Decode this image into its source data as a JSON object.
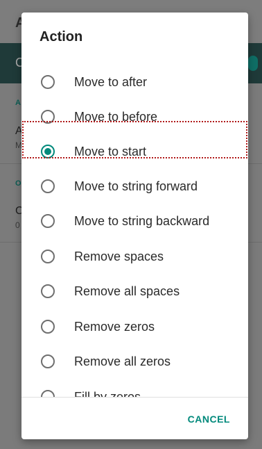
{
  "background": {
    "title_fragment": "A",
    "toolbar_fragment": "C",
    "section_1": "A",
    "item_1": "A",
    "item_1_sub": "M",
    "section_2": "O",
    "item_2": "C",
    "item_2_sub": "0"
  },
  "dialog": {
    "title": "Action",
    "options": [
      {
        "label": "Move to after",
        "checked": false
      },
      {
        "label": "Move to before",
        "checked": false
      },
      {
        "label": "Move to start",
        "checked": true
      },
      {
        "label": "Move to string forward",
        "checked": false
      },
      {
        "label": "Move to string backward",
        "checked": false
      },
      {
        "label": "Remove spaces",
        "checked": false
      },
      {
        "label": "Remove all spaces",
        "checked": false
      },
      {
        "label": "Remove zeros",
        "checked": false
      },
      {
        "label": "Remove all zeros",
        "checked": false
      },
      {
        "label": "Fill by zeros",
        "checked": false
      }
    ],
    "cancel_label": "CANCEL"
  },
  "colors": {
    "accent": "#00897b",
    "highlight_outline": "#b01818"
  }
}
